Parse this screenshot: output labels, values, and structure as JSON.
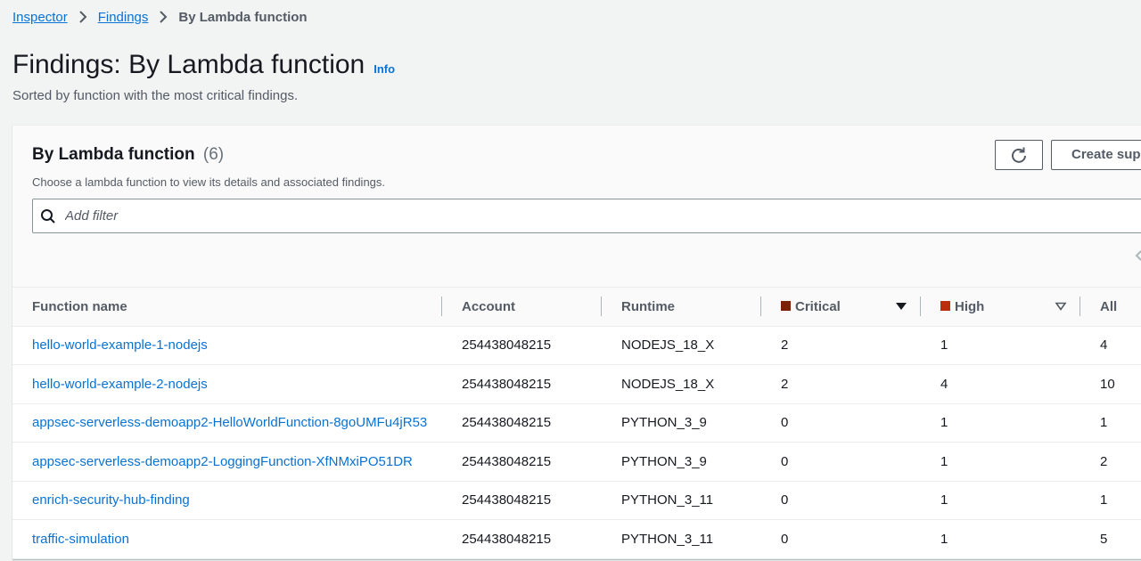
{
  "breadcrumb": {
    "items": [
      {
        "label": "Inspector"
      },
      {
        "label": "Findings"
      }
    ],
    "current": "By Lambda function"
  },
  "page": {
    "title": "Findings: By Lambda function",
    "info_label": "Info",
    "subtitle": "Sorted by function with the most critical findings."
  },
  "panel": {
    "title": "By Lambda function",
    "count": "(6)",
    "description": "Choose a lambda function to view its details and associated findings.",
    "create_button_label": "Create suppression rule",
    "filter_placeholder": "Add filter"
  },
  "table": {
    "columns": {
      "function_name": "Function name",
      "account": "Account",
      "runtime": "Runtime",
      "critical": "Critical",
      "high": "High",
      "all": "All"
    },
    "rows": [
      {
        "function_name": "hello-world-example-1-nodejs",
        "account": "254438048215",
        "runtime": "NODEJS_18_X",
        "critical": "2",
        "high": "1",
        "all": "4"
      },
      {
        "function_name": "hello-world-example-2-nodejs",
        "account": "254438048215",
        "runtime": "NODEJS_18_X",
        "critical": "2",
        "high": "4",
        "all": "10"
      },
      {
        "function_name": "appsec-serverless-demoapp2-HelloWorldFunction-8goUMFu4jR53",
        "account": "254438048215",
        "runtime": "PYTHON_3_9",
        "critical": "0",
        "high": "1",
        "all": "1"
      },
      {
        "function_name": "appsec-serverless-demoapp2-LoggingFunction-XfNMxiPO51DR",
        "account": "254438048215",
        "runtime": "PYTHON_3_9",
        "critical": "0",
        "high": "1",
        "all": "2"
      },
      {
        "function_name": "enrich-security-hub-finding",
        "account": "254438048215",
        "runtime": "PYTHON_3_11",
        "critical": "0",
        "high": "1",
        "all": "1"
      },
      {
        "function_name": "traffic-simulation",
        "account": "254438048215",
        "runtime": "PYTHON_3_11",
        "critical": "0",
        "high": "1",
        "all": "5"
      }
    ]
  },
  "colors": {
    "critical": "#7d2105",
    "high": "#ba2e0f",
    "link": "#0972d3"
  },
  "icons": {
    "breadcrumb_separator": "chevron-right-icon",
    "refresh": "refresh-icon",
    "search": "search-icon",
    "sort_active": "caret-down-filled-icon",
    "sort_inactive": "caret-down-outline-icon",
    "pagination": "chevron-left-icon"
  }
}
